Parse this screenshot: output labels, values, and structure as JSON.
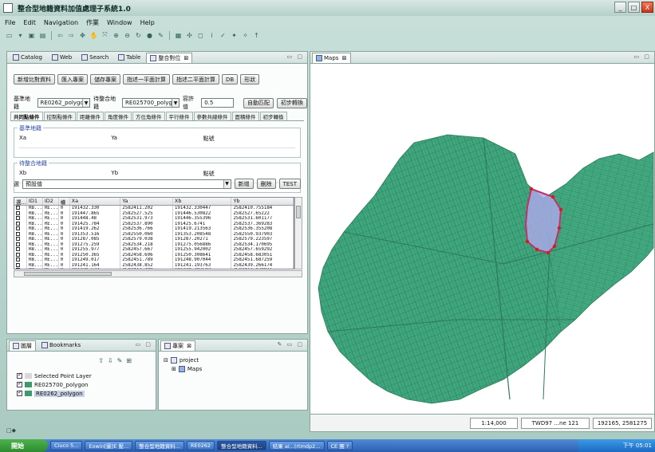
{
  "window": {
    "title": "整合型地籍資料加值處理子系統1.0",
    "controls": [
      "_",
      "□",
      "X"
    ]
  },
  "menu": [
    "File",
    "Edit",
    "Navigation",
    "作業",
    "Window",
    "Help"
  ],
  "left_panel": {
    "tabs": [
      {
        "label": "Catalog",
        "active": false
      },
      {
        "label": "Web",
        "active": false
      },
      {
        "label": "Search",
        "active": false
      },
      {
        "label": "Table",
        "active": false
      },
      {
        "label": "整合對位",
        "active": true
      }
    ],
    "buttons": [
      "新增比對資料",
      "匯入專案",
      "儲存專案",
      "指述一平面計算",
      "指述二平面計算",
      "DB",
      "形狀"
    ],
    "base_layer_label": "基準地籍",
    "base_layer_value": "RE0262_polygon",
    "target_layer_label": "待整合地籍",
    "target_layer_value": "RE025700_polygon",
    "tolerance_label": "容許值",
    "tolerance_value": "0.5",
    "auto_match_btn": "自動匹配",
    "initial_transform_btn": "初步轉換",
    "subtabs": [
      "共同點條件",
      "控制點條件",
      "距離條件",
      "角度條件",
      "方位角條件",
      "平行條件",
      "參數共線條件",
      "面積條件",
      "初步轉換"
    ],
    "base_group": {
      "legend": "基準地籍",
      "cols": [
        "Xa",
        "Ya",
        "點號"
      ]
    },
    "target_group": {
      "legend": "待整合地籍",
      "cols": [
        "Xb",
        "Yb",
        "點號"
      ]
    },
    "row3": {
      "label": "選",
      "select_value": "預設值",
      "new_btn": "新增",
      "delete_btn": "刪除",
      "test_btn": "TEST"
    },
    "table_headers": [
      "選...",
      "ID1",
      "ID2",
      "權",
      "Xa",
      "Ya",
      "Xb",
      "Yb"
    ],
    "table_rows": [
      [
        "RB...",
        "RE...",
        "0",
        "191432.330",
        "2582411.202",
        "191432.330447",
        "2582410.755184"
      ],
      [
        "RB...",
        "RE...",
        "0",
        "191447.865",
        "2582527.525",
        "191446.530822",
        "2582527.65222"
      ],
      [
        "RB...",
        "RE...",
        "0",
        "191448.48",
        "2582531.973",
        "191446.355396",
        "2582531.601177"
      ],
      [
        "RB...",
        "RE...",
        "0",
        "191425.784",
        "2582537.890",
        "191425.6741",
        "2582537.369283"
      ],
      [
        "RB...",
        "RE...",
        "0",
        "191419.262",
        "2582536.766",
        "191419.213563",
        "2582536.355208"
      ],
      [
        "RB...",
        "RE...",
        "0",
        "191353.516",
        "2582550.060",
        "191353.208548",
        "2582550.937903"
      ],
      [
        "RB...",
        "RE...",
        "0",
        "191287.085",
        "2582579.038",
        "191287.20271",
        "2582579.223597"
      ],
      [
        "RB...",
        "RE...",
        "0",
        "191275.259",
        "2582534.218",
        "191275.056886",
        "2582534.170695"
      ],
      [
        "RB...",
        "RE...",
        "0",
        "191255.977",
        "2582457.667",
        "191255.942002",
        "2582457.659292"
      ],
      [
        "RB...",
        "RE...",
        "0",
        "191250.365",
        "2582458.696",
        "191250.308641",
        "2582458.683051"
      ],
      [
        "RB...",
        "RE...",
        "0",
        "191249.017",
        "2582451.789",
        "191248.907044",
        "2582451.687259"
      ],
      [
        "RB...",
        "RE...",
        "0",
        "191241.164",
        "2582438.852",
        "191241.193763",
        "2582439.266174"
      ],
      [
        "RB...",
        "RE...",
        "0",
        "191230.632",
        "2582412.289",
        "191230.397582",
        "2582412.078911"
      ],
      [
        "RB...",
        "RE...",
        "0",
        "191214.808",
        "2582389.987",
        "191214.6798275",
        "2582390.05392"
      ]
    ]
  },
  "layers_panel": {
    "tabs": [
      {
        "label": "圖層"
      },
      {
        "label": "Bookmarks"
      }
    ],
    "items": [
      {
        "label": "Selected Point Layer",
        "checked": true
      },
      {
        "label": "RE025700_polygon",
        "checked": true
      },
      {
        "label": "RE0262_polygon",
        "checked": true,
        "selected": true
      }
    ]
  },
  "project_panel": {
    "tab": "專案",
    "root": "project",
    "child": "Maps"
  },
  "map_panel": {
    "tab": "Maps",
    "scale": "1:14,000",
    "crs": "TWD97 ...ne 121",
    "coords": "192165, 2581275",
    "colors": {
      "parcel_fill": "#3fa77d",
      "parcel_stroke": "#2d7a5c",
      "highlight_fill": "#a8a8e6",
      "highlight_stroke": "#c0306a",
      "point": "#d81b1b"
    }
  },
  "bottom_strip": "□◆",
  "taskbar": {
    "start": "開始",
    "tasks": [
      {
        "label": "Ciuco 5...",
        "active": false
      },
      {
        "label": "Eowin[圖]E 壓...",
        "active": false
      },
      {
        "label": "整合型地籍資料...",
        "active": false
      },
      {
        "label": "RE0262",
        "active": false
      },
      {
        "label": "整合型地籍資料...",
        "active": true
      },
      {
        "label": "結果 ai...(rtmdp2...",
        "active": false
      },
      {
        "label": "CE 團 ? ",
        "active": false
      }
    ],
    "clock": "下午 05:01"
  }
}
